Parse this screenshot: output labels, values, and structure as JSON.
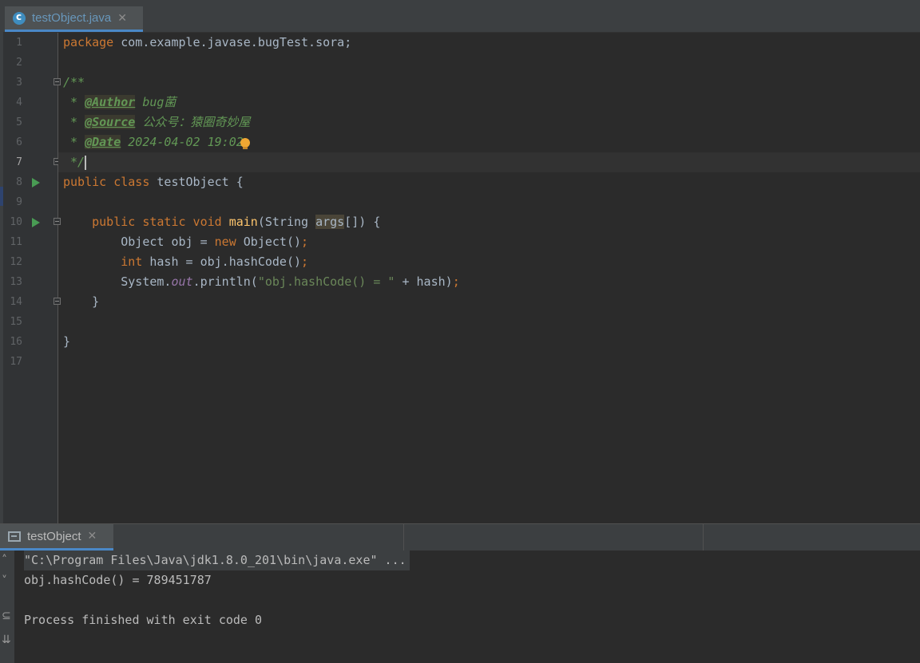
{
  "editor_tab": {
    "filename": "testObject.java",
    "close": "✕"
  },
  "editor": {
    "line_numbers": [
      "1",
      "2",
      "3",
      "4",
      "5",
      "6",
      "7",
      "8",
      "9",
      "10",
      "11",
      "12",
      "13",
      "14",
      "15",
      "16",
      "17"
    ],
    "code": {
      "l1_kw": "package",
      "l1_rest": " com.example.javase.bugTest.sora;",
      "l3": "/**",
      "l4_pre": " * ",
      "l4_tag": "@Author",
      "l4_val": " bug菌",
      "l5_pre": " * ",
      "l5_tag": "@Source",
      "l5_val": " 公众号：猿圈奇妙屋",
      "l6_pre": " * ",
      "l6_tag": "@Date",
      "l6_val": " 2024-04-02 19:02",
      "l7": " */",
      "l8_kw": "public class",
      "l8_rest": " testObject {",
      "l10_indent": "    ",
      "l10_kw": "public static void",
      "l10_sp": " ",
      "l10_fn": "main",
      "l10_a": "(String ",
      "l10_param": "args",
      "l10_b": "[]) {",
      "l11_a": "        Object obj = ",
      "l11_kw": "new",
      "l11_b": " Object()",
      "l11_semi": ";",
      "l12_indent": "        ",
      "l12_kw": "int",
      "l12_b": " hash = obj.hashCode()",
      "l12_semi": ";",
      "l13_a": "        System.",
      "l13_fld": "out",
      "l13_b": ".println(",
      "l13_str": "\"obj.hashCode() = \"",
      "l13_c": " + hash)",
      "l13_semi": ";",
      "l14": "    }",
      "l16": "}"
    }
  },
  "run_tab": {
    "label": "testObject",
    "close": "✕"
  },
  "run_toolbar": {
    "up": "˄",
    "down": "˅",
    "wrap": "⊆",
    "scroll": "⇊"
  },
  "console": {
    "command": "\"C:\\Program Files\\Java\\jdk1.8.0_201\\bin\\java.exe\" ...",
    "output": "obj.hashCode() = 789451787",
    "exit": "Process finished with exit code 0"
  },
  "colors": {
    "keyword": "#cc7832",
    "doc_comment": "#629755",
    "method": "#ffc66d",
    "string": "#6a8759",
    "static_field": "#9876aa",
    "default_text": "#a9b7c6",
    "tab_underline": "#4a88c7",
    "run_gutter_icon": "#499c54",
    "intention_bulb": "#f0a732"
  }
}
